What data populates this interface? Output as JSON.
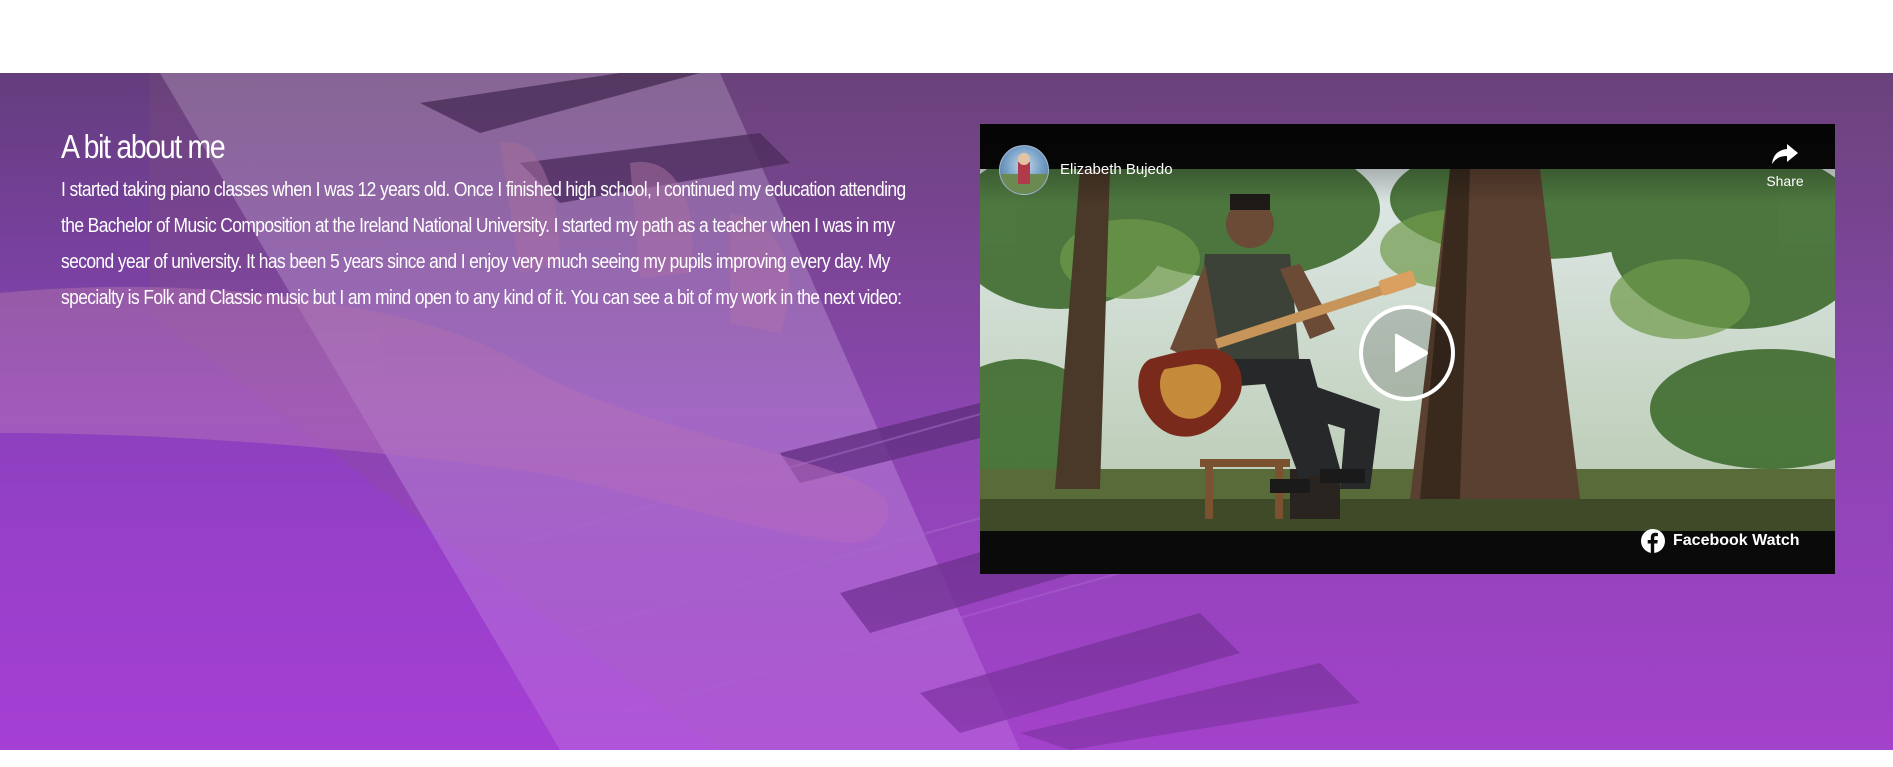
{
  "about": {
    "title": "A bit about me",
    "body": "I started taking piano classes when I was 12 years old. Once I finished high school, I continued my education attending the Bachelor of Music Composition at the Ireland National University. I started my path as a teacher when I was in my second year of university. It has been 5 years since and I enjoy very much seeing my pupils improving every day. My specialty is Folk and Classic music but I am mind open to any kind of it. You can see a bit of my work in the next video:"
  },
  "video": {
    "channel_name": "Elizabeth Bujedo",
    "share_label": "Share",
    "platform_label": "Facebook Watch",
    "icons": {
      "share": "share-arrow-icon",
      "play": "play-icon",
      "platform": "facebook-icon"
    }
  },
  "colors": {
    "overlay_top": "#6b3f8a",
    "overlay_bottom": "#a23fd0",
    "text": "#ffffff",
    "video_bg": "#0a0a0a"
  }
}
